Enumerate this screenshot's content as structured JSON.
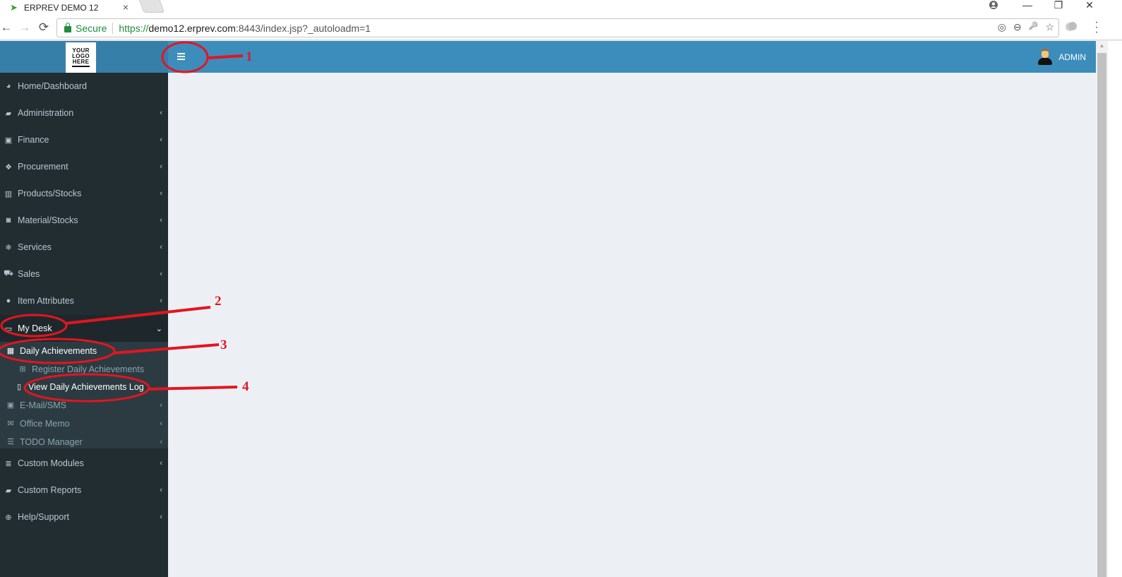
{
  "browser": {
    "tab_title": "ERPREV DEMO 12",
    "tab_close": "×",
    "secure_label": "Secure",
    "url_scheme": "https://",
    "url_host": "demo12.erprev.com",
    "url_rest": ":8443/index.jsp?_autoloadm=1",
    "window_controls": {
      "minimize": "—",
      "restore": "❐",
      "close": "✕"
    },
    "nav": {
      "back": "←",
      "forward": "→",
      "reload": "⟳"
    },
    "omnibox_icons": [
      "◎",
      "⊖",
      "🔑",
      "☆"
    ]
  },
  "header": {
    "logo_lines": [
      "YOUR",
      "LOGO",
      "HERE"
    ],
    "user_name": "ADMIN",
    "accent_color": "#3c8dbc"
  },
  "sidebar": {
    "items": [
      {
        "label": "Home/Dashboard",
        "icon": "dashboard-icon",
        "glyph": "◕",
        "has_children": false
      },
      {
        "label": "Administration",
        "icon": "ticket-icon",
        "glyph": "▰",
        "has_children": true
      },
      {
        "label": "Finance",
        "icon": "money-icon",
        "glyph": "▣",
        "has_children": true
      },
      {
        "label": "Procurement",
        "icon": "cubes-icon",
        "glyph": "❖",
        "has_children": true
      },
      {
        "label": "Products/Stocks",
        "icon": "building-icon",
        "glyph": "▥",
        "has_children": true
      },
      {
        "label": "Material/Stocks",
        "icon": "trash-bin-icon",
        "glyph": "◙",
        "has_children": true
      },
      {
        "label": "Services",
        "icon": "snowflake-icon",
        "glyph": "❄",
        "has_children": true
      },
      {
        "label": "Sales",
        "icon": "cart-icon",
        "glyph": "⛟",
        "has_children": true
      },
      {
        "label": "Item Attributes",
        "icon": "attributes-icon",
        "glyph": "●",
        "has_children": true
      },
      {
        "label": "My Desk",
        "icon": "desk-icon",
        "glyph": "▭",
        "has_children": true,
        "expanded": true
      },
      {
        "label": "Custom Modules",
        "icon": "database-icon",
        "glyph": "≣",
        "has_children": true
      },
      {
        "label": "Custom Reports",
        "icon": "book-icon",
        "glyph": "▰",
        "has_children": true
      },
      {
        "label": "Help/Support",
        "icon": "life-ring-icon",
        "glyph": "⊕",
        "has_children": true
      }
    ],
    "my_desk_children": [
      {
        "label": "Daily Achievements",
        "icon": "calendar-icon",
        "glyph": "▦",
        "expanded": true,
        "children": [
          {
            "label": "Register Daily Achievements",
            "icon": "calendar-plus-icon",
            "glyph": "⊞"
          },
          {
            "label": "View Daily Achievements Log",
            "icon": "clipboard-icon",
            "glyph": "▯",
            "current": true
          }
        ]
      },
      {
        "label": "E-Mail/SMS",
        "icon": "mail-box-icon",
        "glyph": "▣"
      },
      {
        "label": "Office Memo",
        "icon": "envelope-icon",
        "glyph": "✉"
      },
      {
        "label": "TODO Manager",
        "icon": "server-icon",
        "glyph": "☰"
      }
    ],
    "chevron_collapsed": "‹",
    "chevron_expanded": "⌄"
  },
  "annotations": {
    "color": "#e3151f",
    "labels": [
      "1",
      "2",
      "3",
      "4"
    ]
  }
}
